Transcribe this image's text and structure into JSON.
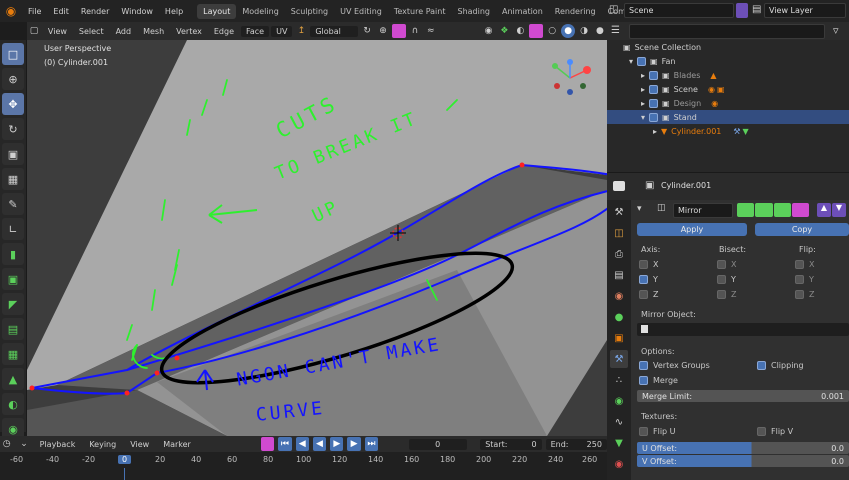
{
  "topbar": {
    "menus": [
      "File",
      "Edit",
      "Render",
      "Window",
      "Help"
    ],
    "workspaces": [
      "Layout",
      "Modeling",
      "Sculpting",
      "UV Editing",
      "Texture Paint",
      "Shading",
      "Animation",
      "Rendering",
      "Compositing"
    ],
    "active_workspace": "Layout",
    "scene": "Scene",
    "view_layer": "View Layer"
  },
  "viewport_header": {
    "menus": [
      "View",
      "Select",
      "Add",
      "Mesh",
      "Vertex",
      "Edge",
      "Face",
      "UV"
    ],
    "orientation": "Global"
  },
  "viewport": {
    "perspective": "User Perspective",
    "object": "(0) Cylinder.001",
    "annotations": {
      "top": [
        "CUTS",
        "TO BREAK IT",
        "UP"
      ],
      "bottom": [
        "NGON CAN'T MAKE",
        "CURVE"
      ]
    }
  },
  "timeline": {
    "menus": [
      "Playback",
      "Keying",
      "View",
      "Marker"
    ],
    "current_frame": "0",
    "start_label": "Start:",
    "start": "0",
    "end_label": "End:",
    "end": "250",
    "ruler": [
      "-60",
      "-40",
      "-20",
      "0",
      "20",
      "40",
      "60",
      "80",
      "100",
      "120",
      "140",
      "160",
      "180",
      "200",
      "220",
      "240",
      "260"
    ]
  },
  "outliner": {
    "search_placeholder": "",
    "items": [
      {
        "label": "Scene Collection",
        "indent": 0
      },
      {
        "label": "Fan",
        "indent": 1
      },
      {
        "label": "Blades",
        "indent": 2
      },
      {
        "label": "Scene",
        "indent": 2
      },
      {
        "label": "Design",
        "indent": 2
      },
      {
        "label": "Stand",
        "indent": 2
      },
      {
        "label": "Cylinder.001",
        "indent": 3
      }
    ]
  },
  "properties": {
    "object_name": "Cylinder.001",
    "modifier_name": "Mirror",
    "apply": "Apply",
    "copy": "Copy",
    "axis_label": "Axis:",
    "bisect_label": "Bisect:",
    "flip_label": "Flip:",
    "axes": [
      "X",
      "Y",
      "Z"
    ],
    "axis_checked": [
      false,
      true,
      false
    ],
    "mirror_object_label": "Mirror Object:",
    "options_label": "Options:",
    "vertex_groups": "Vertex Groups",
    "clipping": "Clipping",
    "merge": "Merge",
    "merge_limit_label": "Merge Limit:",
    "merge_limit": "0.001",
    "textures_label": "Textures:",
    "flip_u": "Flip U",
    "flip_v": "Flip V",
    "u_offset_label": "U Offset:",
    "u_offset": "0.0",
    "v_offset_label": "V Offset:",
    "v_offset": "0.0"
  },
  "colors": {
    "accent": "#4772b3",
    "annotation_green": "#2ef02e",
    "annotation_blue": "#1414ff",
    "orange": "#e87d0d"
  }
}
